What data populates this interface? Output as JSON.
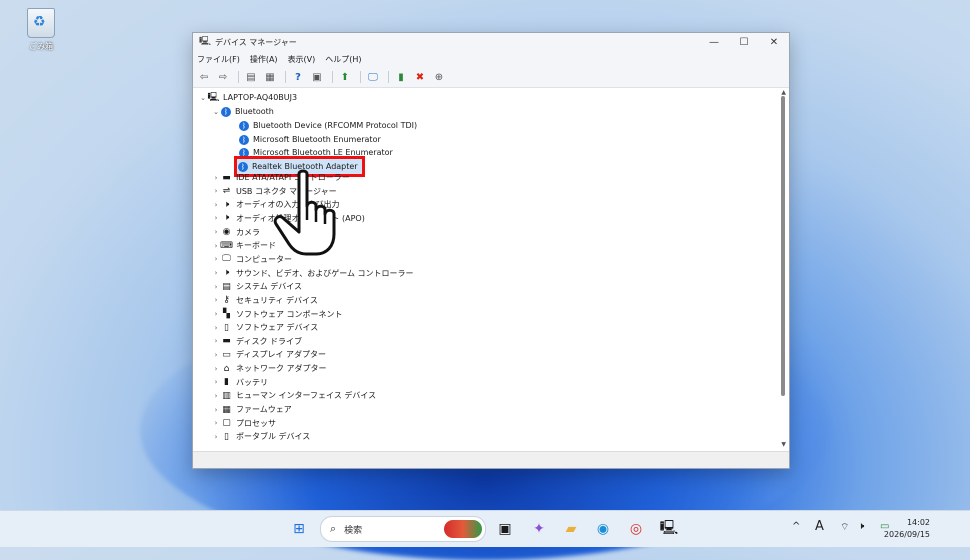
{
  "desktop": {
    "recycle_bin_label": "ごみ箱"
  },
  "window": {
    "title": "デバイス マネージャー",
    "menu": [
      "ファイル(F)",
      "操作(A)",
      "表示(V)",
      "ヘルプ(H)"
    ]
  },
  "tree": {
    "root": "LAPTOP-AQ40BUJ3",
    "bluetooth_category": "Bluetooth",
    "bluetooth_devices": [
      "Bluetooth Device (RFCOMM Protocol TDI)",
      "Microsoft Bluetooth Enumerator",
      "Microsoft Bluetooth LE Enumerator",
      "Realtek Bluetooth Adapter"
    ],
    "categories": [
      "IDE ATA/ATAPI コントローラー",
      "USB コネクタ マネージャー",
      "オーディオの入力および出力",
      "オーディオ処理オブジェクト (APO)",
      "カメラ",
      "キーボード",
      "コンピューター",
      "サウンド、ビデオ、およびゲーム コントローラー",
      "システム デバイス",
      "セキュリティ デバイス",
      "ソフトウェア コンポーネント",
      "ソフトウェア デバイス",
      "ディスク ドライブ",
      "ディスプレイ アダプター",
      "ネットワーク アダプター",
      "バッテリ",
      "ヒューマン インターフェイス デバイス",
      "ファームウェア",
      "プロセッサ",
      "ポータブル デバイス"
    ]
  },
  "taskbar": {
    "search_placeholder": "検索",
    "ime_indicator": "A",
    "time": "14:02",
    "date": "2026/09/15"
  },
  "colors": {
    "accent": "#1e6fd9",
    "highlight_border": "#e11111"
  }
}
